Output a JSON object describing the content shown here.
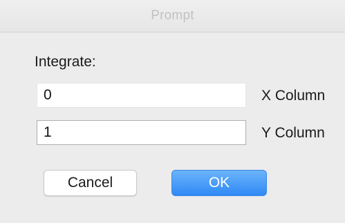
{
  "dialog": {
    "title": "Prompt",
    "prompt_label": "Integrate:",
    "fields": [
      {
        "value": "0",
        "label": "X Column"
      },
      {
        "value": "1",
        "label": "Y Column"
      }
    ],
    "buttons": {
      "cancel_label": "Cancel",
      "ok_label": "OK"
    }
  },
  "colors": {
    "window_background": "#ececec",
    "default_button": "#3c8ff7",
    "title_text": "#c2c2c2"
  }
}
